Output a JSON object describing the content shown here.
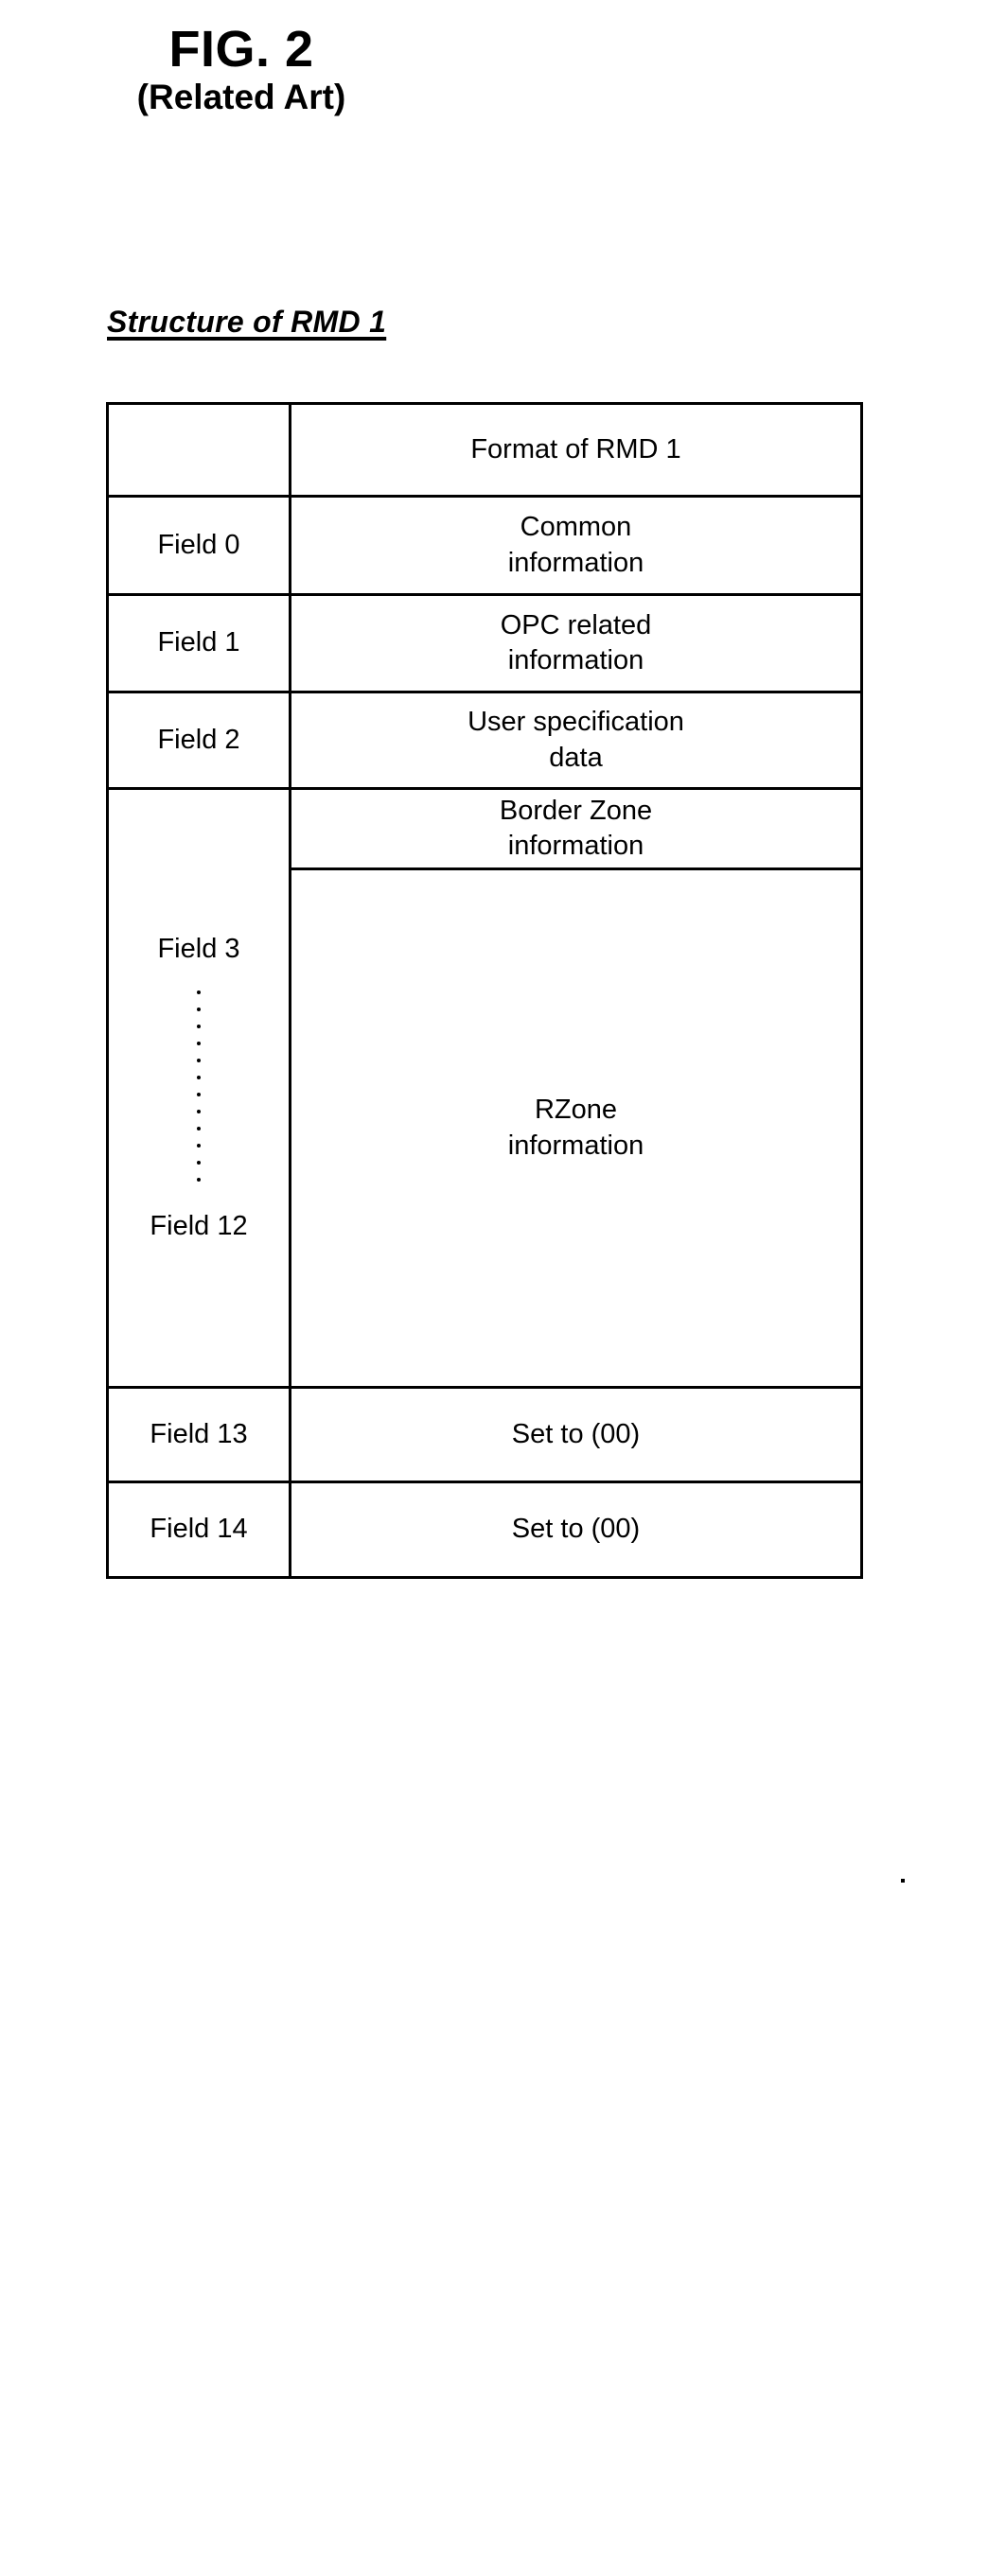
{
  "figure": {
    "number": "FIG. 2",
    "subtitle": "(Related Art)",
    "caption": "Structure of RMD 1"
  },
  "table": {
    "columns": [
      "",
      ""
    ],
    "rows": [
      {
        "label": "",
        "value": "Format of RMD 1"
      },
      {
        "label": "Field 0",
        "value": "Common\ninformation"
      },
      {
        "label": "Field 1",
        "value": "OPC related\ninformation"
      },
      {
        "label": "Field 2",
        "value": "User specification\ndata"
      },
      {
        "label_top": "Field 3",
        "label_bottom": "Field 12",
        "value_top": "Border Zone\ninformation",
        "value_bottom": "RZone\ninformation"
      },
      {
        "label": "Field 13",
        "value": "Set to (00)"
      },
      {
        "label": "Field 14",
        "value": "Set to (00)"
      }
    ]
  },
  "style": {
    "ink_color": "#000000",
    "paper_color": "#ffffff"
  }
}
